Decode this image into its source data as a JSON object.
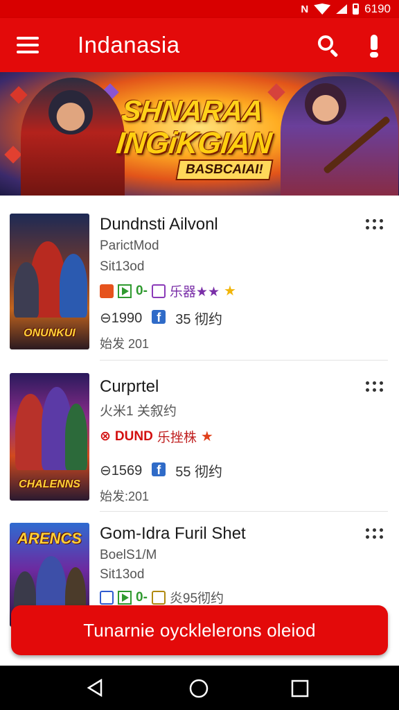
{
  "status_bar": {
    "time": "6190"
  },
  "app_bar": {
    "title": "Indanasia",
    "menu_icon": "menu-icon",
    "search_icon": "search-icon",
    "alert_icon": "alert-icon"
  },
  "banner": {
    "line1": "SHNARAA",
    "line2": "INGiKGIAN",
    "sub": "BASBCAIAI!"
  },
  "games": [
    {
      "title": "Dundnsti Ailvonl",
      "subtitle": "ParictMod",
      "subtitle2": "Sit13od",
      "cover_text": "ONUNKUI",
      "badge_text": "0-",
      "tags": "乐器★★",
      "rating_text": "⊖1990",
      "social": "35 彻约",
      "date": "始发 201"
    },
    {
      "title": "Curprtel",
      "subtitle": "火米1 关叙约",
      "cover_text": "CHALENNS",
      "badge_text": "DUND",
      "tags": "乐挫株",
      "rating_text": "⊖1569",
      "social": "55 彻约",
      "date": "始发:201"
    },
    {
      "title": "Gom-Idra Furil Shet",
      "subtitle": "BoelS1/M",
      "subtitle2": "Sit13od",
      "cover_text": "ARENCS",
      "badge_text": "0-",
      "tags": "炎95彻约"
    }
  ],
  "cta_label": "Tunarnie oycklelerons oleiod",
  "colors": {
    "primary": "#e30a0a",
    "status": "#d80000"
  }
}
